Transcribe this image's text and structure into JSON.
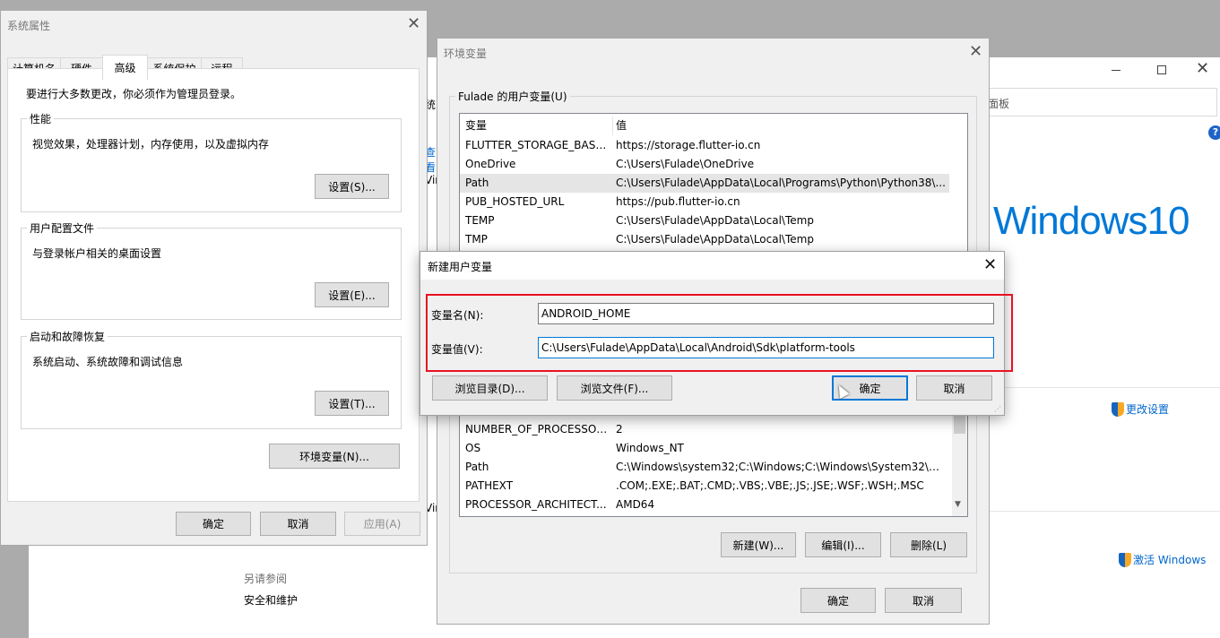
{
  "background_window": {
    "search_partial": "面板",
    "windows10_logo": "Windows10",
    "change_settings_link": "更改设置",
    "activate_windows_link": "激活 Windows",
    "see_also_label": "另请参阅",
    "security_link": "安全和维护",
    "left_partial": [
      "统",
      "查看",
      "Vin",
      "Vin"
    ]
  },
  "sys_props": {
    "title": "系统属性",
    "tabs": [
      "计算机名",
      "硬件",
      "高级",
      "系统保护",
      "远程"
    ],
    "intro": "要进行大多数更改，你必须作为管理员登录。",
    "performance": {
      "label": "性能",
      "desc": "视觉效果，处理器计划，内存使用，以及虚拟内存",
      "button": "设置(S)..."
    },
    "profile": {
      "label": "用户配置文件",
      "desc": "与登录帐户相关的桌面设置",
      "button": "设置(E)..."
    },
    "startup": {
      "label": "启动和故障恢复",
      "desc": "系统启动、系统故障和调试信息",
      "button": "设置(T)..."
    },
    "env_button": "环境变量(N)...",
    "ok": "确定",
    "cancel": "取消",
    "apply": "应用(A)"
  },
  "env_vars": {
    "title": "环境变量",
    "user_group_label": "Fulade 的用户变量(U)",
    "col_var": "变量",
    "col_val": "值",
    "user_rows": [
      {
        "name": "FLUTTER_STORAGE_BASE_...",
        "value": "https://storage.flutter-io.cn"
      },
      {
        "name": "OneDrive",
        "value": "C:\\Users\\Fulade\\OneDrive"
      },
      {
        "name": "Path",
        "value": "C:\\Users\\Fulade\\AppData\\Local\\Programs\\Python\\Python38\\..."
      },
      {
        "name": "PUB_HOSTED_URL",
        "value": "https://pub.flutter-io.cn"
      },
      {
        "name": "TEMP",
        "value": "C:\\Users\\Fulade\\AppData\\Local\\Temp"
      },
      {
        "name": "TMP",
        "value": "C:\\Users\\Fulade\\AppData\\Local\\Temp"
      }
    ],
    "sys_rows": [
      {
        "name": "NUMBER_OF_PROCESSORS",
        "value": "2"
      },
      {
        "name": "OS",
        "value": "Windows_NT"
      },
      {
        "name": "Path",
        "value": "C:\\Windows\\system32;C:\\Windows;C:\\Windows\\System32\\Wb..."
      },
      {
        "name": "PATHEXT",
        "value": ".COM;.EXE;.BAT;.CMD;.VBS;.VBE;.JS;.JSE;.WSF;.WSH;.MSC"
      },
      {
        "name": "PROCESSOR_ARCHITECT...",
        "value": "AMD64"
      }
    ],
    "new_button": "新建(W)...",
    "edit_button": "编辑(I)...",
    "delete_button": "删除(L)",
    "ok": "确定",
    "cancel": "取消"
  },
  "new_var": {
    "title": "新建用户变量",
    "name_label": "变量名(N):",
    "name_value": "ANDROID_HOME",
    "value_label": "变量值(V):",
    "value_value": "C:\\Users\\Fulade\\AppData\\Local\\Android\\Sdk\\platform-tools",
    "browse_dir": "浏览目录(D)...",
    "browse_file": "浏览文件(F)...",
    "ok": "确定",
    "cancel": "取消"
  },
  "colors": {
    "highlight_box": "#e81123",
    "link": "#0066cc",
    "win10_blue": "#0078d7",
    "focus_border": "#0078d7"
  }
}
